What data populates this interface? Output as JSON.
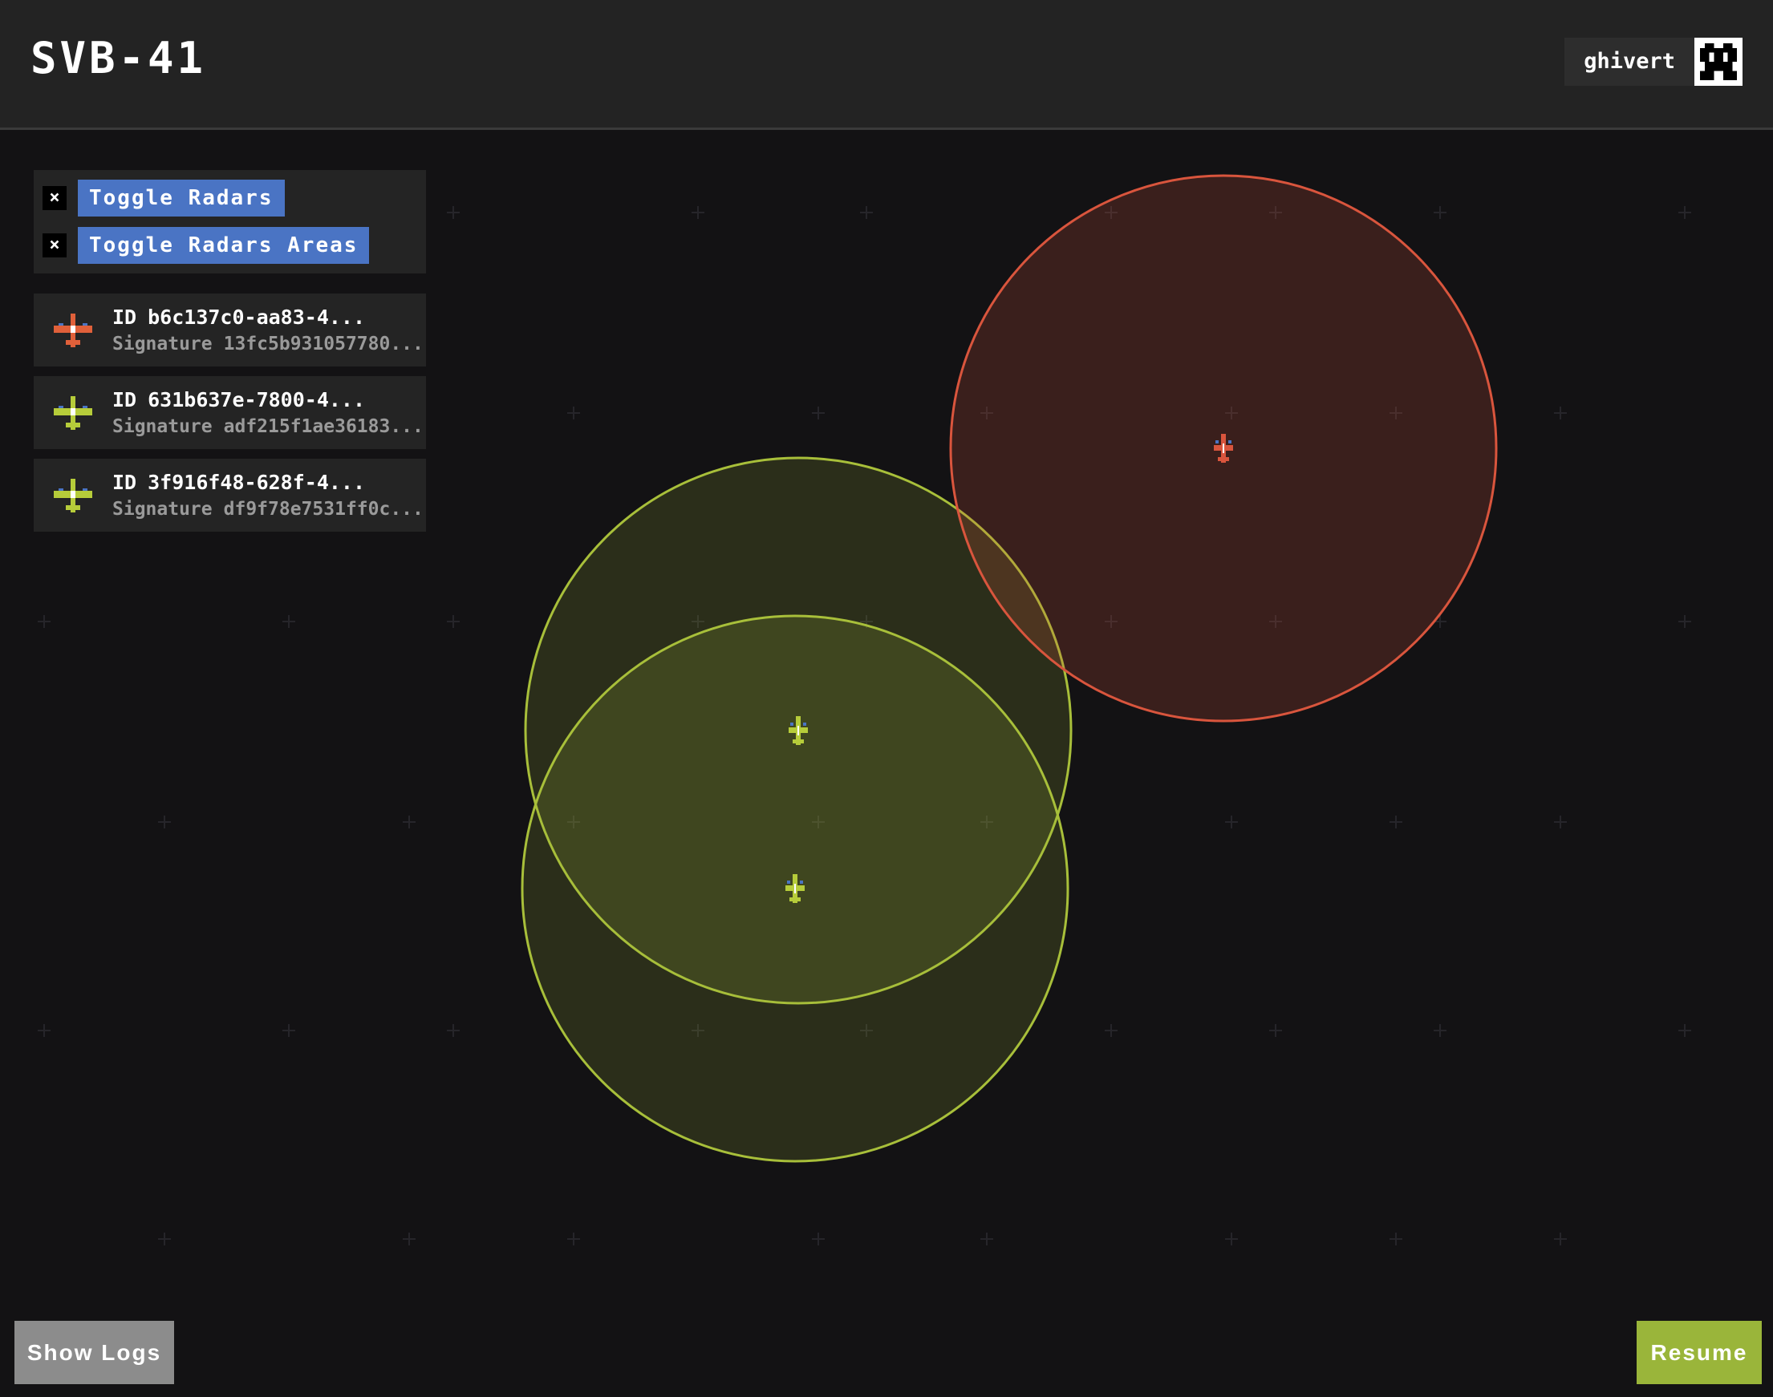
{
  "header": {
    "title": "SVB-41",
    "user": {
      "name": "ghivert",
      "avatar_icon": "pixel-avatar-icon"
    }
  },
  "controls": {
    "toggles": [
      {
        "checkbox": "×",
        "label": "Toggle Radars",
        "checked": true
      },
      {
        "checkbox": "×",
        "label": "Toggle Radars Areas",
        "checked": true
      }
    ]
  },
  "radars": [
    {
      "id_key": "ID",
      "id_value": "b6c137c0-aa83-4...",
      "signature_key": "Signature",
      "signature_value": "13fc5b931057780...",
      "color": "#e0603a",
      "icon": "plane-icon"
    },
    {
      "id_key": "ID",
      "id_value": "631b637e-7800-4...",
      "signature_key": "Signature",
      "signature_value": "adf215f1ae36183...",
      "color": "#b6cc3a",
      "icon": "plane-icon"
    },
    {
      "id_key": "ID",
      "id_value": "3f916f48-628f-4...",
      "signature_key": "Signature",
      "signature_value": "df9f78e7531ff0c...",
      "color": "#b6cc3a",
      "icon": "plane-icon"
    }
  ],
  "map": {
    "background": "#131214",
    "radar_area_colors": {
      "red": "#d9553d",
      "green": "#a8bf3a"
    }
  },
  "buttons": {
    "show_logs": "Show Logs",
    "resume": "Resume"
  },
  "colors": {
    "accent_blue": "#4a74c4",
    "resume_green": "#9ab53a",
    "logs_gray": "#8c8c8c"
  }
}
